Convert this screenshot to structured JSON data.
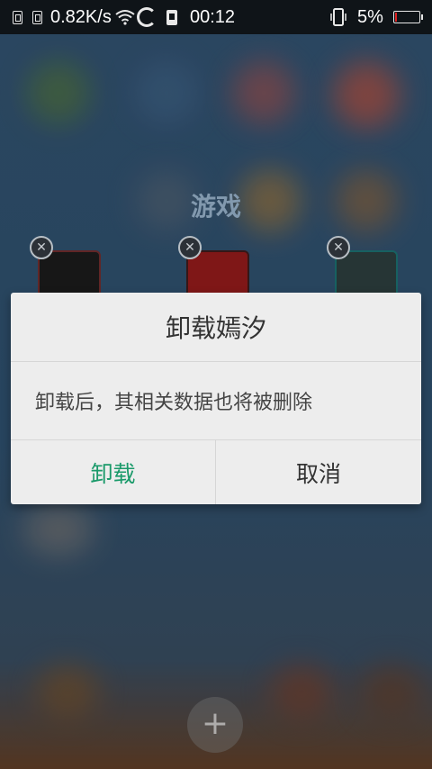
{
  "status_bar": {
    "net_speed": "0.82K/s",
    "time": "00:12",
    "battery_percent": "5%",
    "battery_level": 0.05,
    "icons": [
      "sim1-icon",
      "sim2-icon",
      "wifi-icon",
      "loading-spinner-icon",
      "sd-card-icon",
      "vibrate-icon",
      "battery-icon"
    ]
  },
  "folder": {
    "title": "游戏",
    "remove_icon": "close-circle-icon",
    "add_icon": "plus-icon",
    "add_symbol": "+"
  },
  "dialog": {
    "title": "卸载嫣汐",
    "message": "卸载后，其相关数据也将被删除",
    "confirm_label": "卸载",
    "cancel_label": "取消"
  },
  "colors": {
    "accent": "#1a9a6a",
    "battery_low": "#e02020",
    "dialog_bg": "#ededed"
  }
}
